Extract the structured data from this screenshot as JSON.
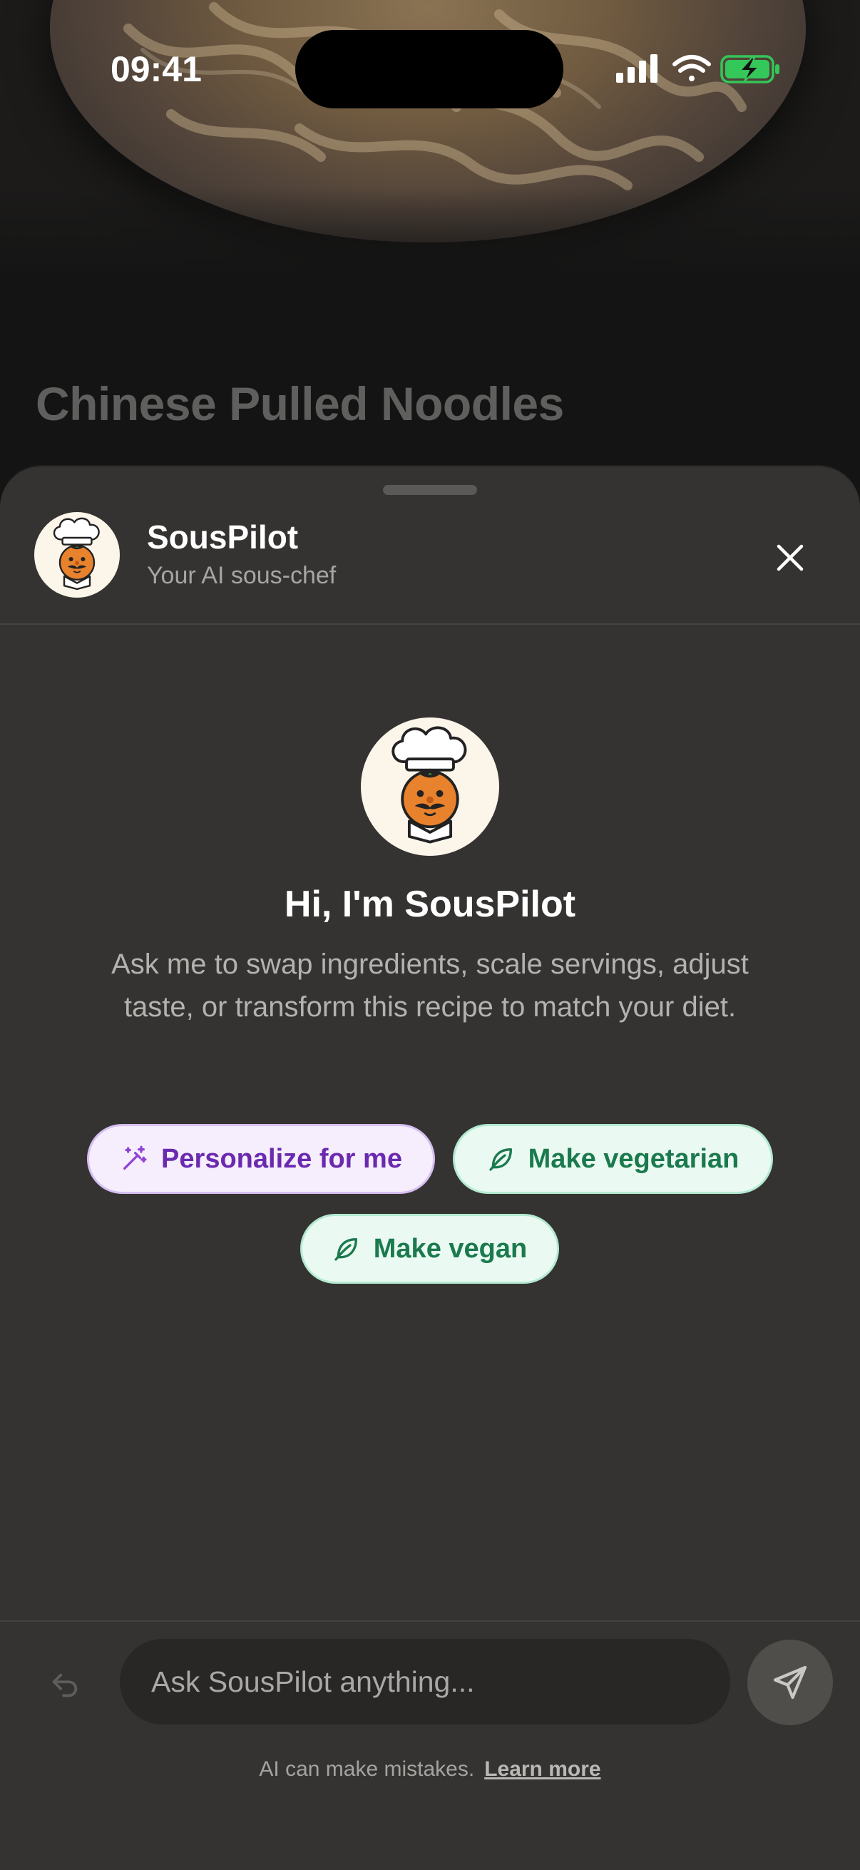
{
  "status_bar": {
    "time": "09:41"
  },
  "recipe": {
    "title": "Chinese Pulled Noodles"
  },
  "assistant": {
    "name": "SousPilot",
    "subtitle": "Your AI sous-chef",
    "greeting": "Hi, I'm SousPilot",
    "intro": "Ask me to swap ingredients, scale servings, adjust taste, or transform this recipe to match your diet."
  },
  "suggestions": [
    {
      "label": "Personalize for me",
      "icon": "magic-wand-icon"
    },
    {
      "label": "Make vegetarian",
      "icon": "leaf-icon"
    },
    {
      "label": "Make vegan",
      "icon": "leaf-icon"
    }
  ],
  "composer": {
    "placeholder": "Ask SousPilot anything..."
  },
  "disclaimer": {
    "text": "AI can make mistakes.",
    "link": "Learn more"
  },
  "colors": {
    "sheet": "#343331",
    "accent_purple": "#6a2ab0",
    "accent_green": "#1b7a4d",
    "battery": "#34c759"
  }
}
